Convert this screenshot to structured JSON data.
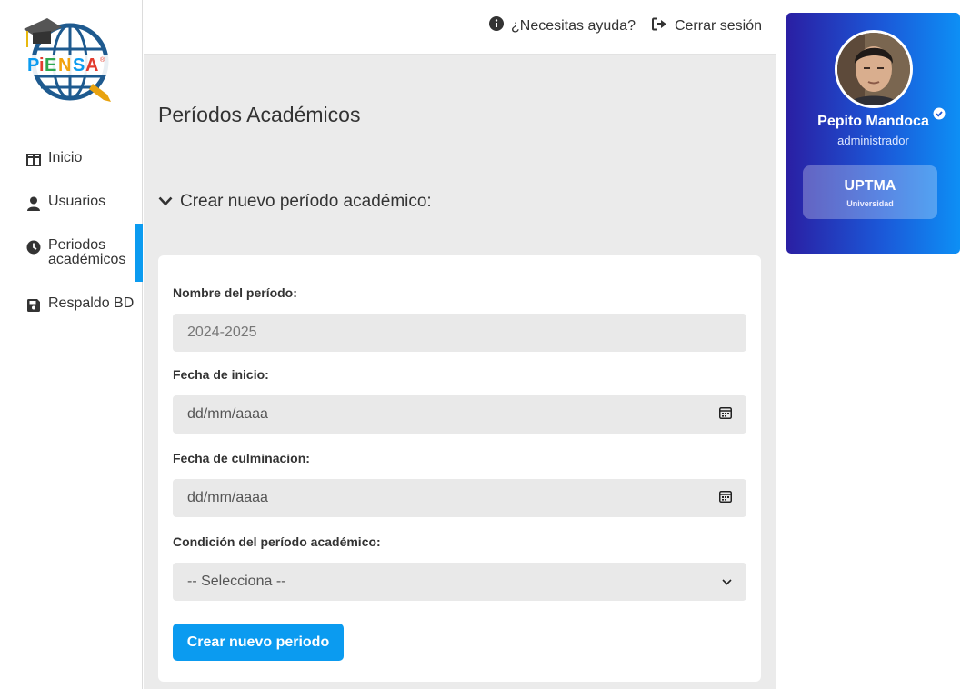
{
  "brand": {
    "logo_text": "PiENSA"
  },
  "sidebar": {
    "items": [
      {
        "label": "Inicio",
        "icon": "layout-icon"
      },
      {
        "label": "Usuarios",
        "icon": "user-icon"
      },
      {
        "label_line1": "Periodos",
        "label_line2": "académicos",
        "icon": "clock-icon",
        "active": true
      },
      {
        "label": "Respaldo BD",
        "icon": "floppy-disk-icon"
      }
    ]
  },
  "topbar": {
    "help_label": "¿Necesitas ayuda?",
    "logout_label": "Cerrar sesión"
  },
  "main": {
    "page_title": "Períodos Académicos",
    "section_title": "Crear nuevo período académico:",
    "form": {
      "name_label": "Nombre del período:",
      "name_value": "2024-2025",
      "start_label": "Fecha de inicio:",
      "start_placeholder": "dd/mm/aaaa",
      "end_label": "Fecha de culminacion:",
      "end_placeholder": "dd/mm/aaaa",
      "condition_label": "Condición del período académico:",
      "condition_selected": "-- Selecciona --",
      "submit_label": "Crear nuevo periodo"
    }
  },
  "profile": {
    "name": "Pepito Mandoca",
    "role": "administrador",
    "university": "UPTMA",
    "university_caption": "Universidad"
  },
  "colors": {
    "accent": "#0b9bf0",
    "background": "#ebebeb",
    "card_gradient_start": "#2a1fa3",
    "card_gradient_end": "#0d8ff5"
  }
}
